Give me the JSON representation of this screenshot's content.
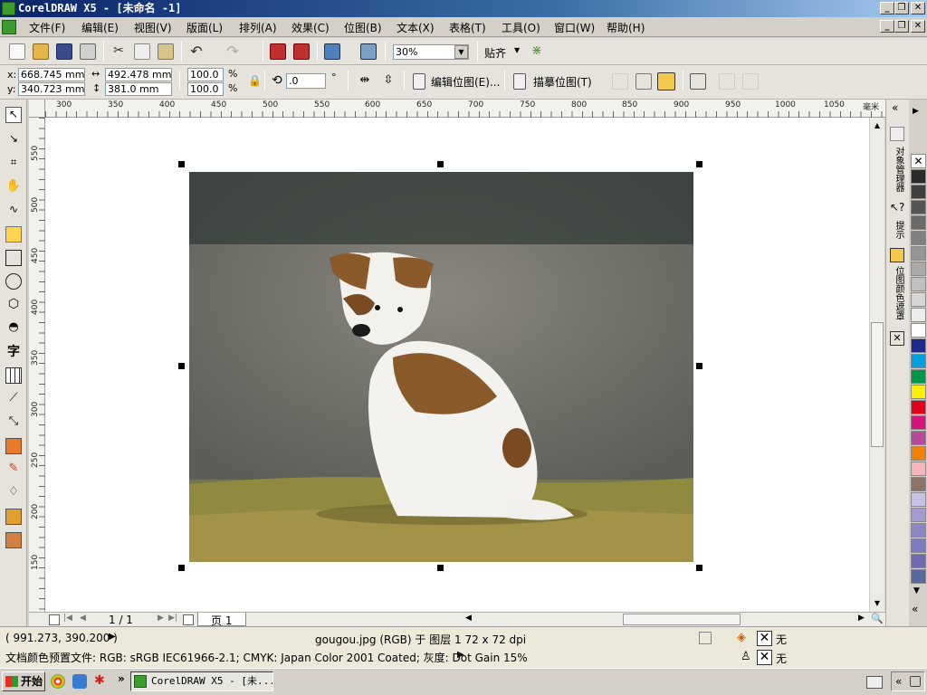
{
  "app": {
    "title": "CorelDRAW X5 - [未命名 -1]"
  },
  "menu": [
    "文件(F)",
    "编辑(E)",
    "视图(V)",
    "版面(L)",
    "排列(A)",
    "效果(C)",
    "位图(B)",
    "文本(X)",
    "表格(T)",
    "工具(O)",
    "窗口(W)",
    "帮助(H)"
  ],
  "toolbar": {
    "zoom": "30%",
    "snap_label": "贴齐"
  },
  "property_bar": {
    "x_label": "x:",
    "y_label": "y:",
    "x": "668.745 mm",
    "y": "340.723 mm",
    "width": "492.478 mm",
    "height": "381.0 mm",
    "scale_x": "100.0",
    "scale_y": "100.0",
    "percent": "%",
    "angle": ".0",
    "degree": "°",
    "edit_bitmap": "编辑位图(E)...",
    "trace_bitmap": "描摹位图(T)"
  },
  "ruler": {
    "top": [
      "300",
      "350",
      "400",
      "450",
      "500",
      "550",
      "600",
      "650",
      "700",
      "750",
      "800",
      "850",
      "900",
      "950",
      "1000",
      "1050"
    ],
    "top_unit": "毫米",
    "left": [
      "550",
      "500",
      "450",
      "400",
      "350",
      "300",
      "250",
      "200",
      "150"
    ]
  },
  "page_nav": {
    "counter": "1 / 1",
    "tab": "页 1"
  },
  "dockers": [
    "对象管理器",
    "提示",
    "位图颜色遮罩"
  ],
  "palette": [
    "#2b2b2b",
    "#404040",
    "#555555",
    "#6a6a6a",
    "#808080",
    "#969696",
    "#aaaaaa",
    "#c0c0c0",
    "#d6d6d6",
    "#ececec",
    "#ffffff",
    "#1f2a8f",
    "#00a0e0",
    "#00964a",
    "#ffef00",
    "#e3001b",
    "#d4147a",
    "#b8499a",
    "#f08000",
    "#f4b6b6",
    "#8a7566",
    "#c6c2e8",
    "#a49ad0",
    "#8c86c6",
    "#7d7ac0",
    "#6f6cb4",
    "#5a68a0"
  ],
  "status": {
    "coords": "( 991.273, 390.200 )",
    "object_info": "gougou.jpg (RGB) 于 图层 1 72 x 72 dpi",
    "color_profile": "文档颜色预置文件: RGB: sRGB IEC61966-2.1; CMYK: Japan Color 2001 Coated; 灰度: Dot Gain 15%",
    "fill_none": "无",
    "outline_none": "无"
  },
  "taskbar": {
    "start": "开始",
    "task": "CorelDRAW X5 - [未..."
  }
}
